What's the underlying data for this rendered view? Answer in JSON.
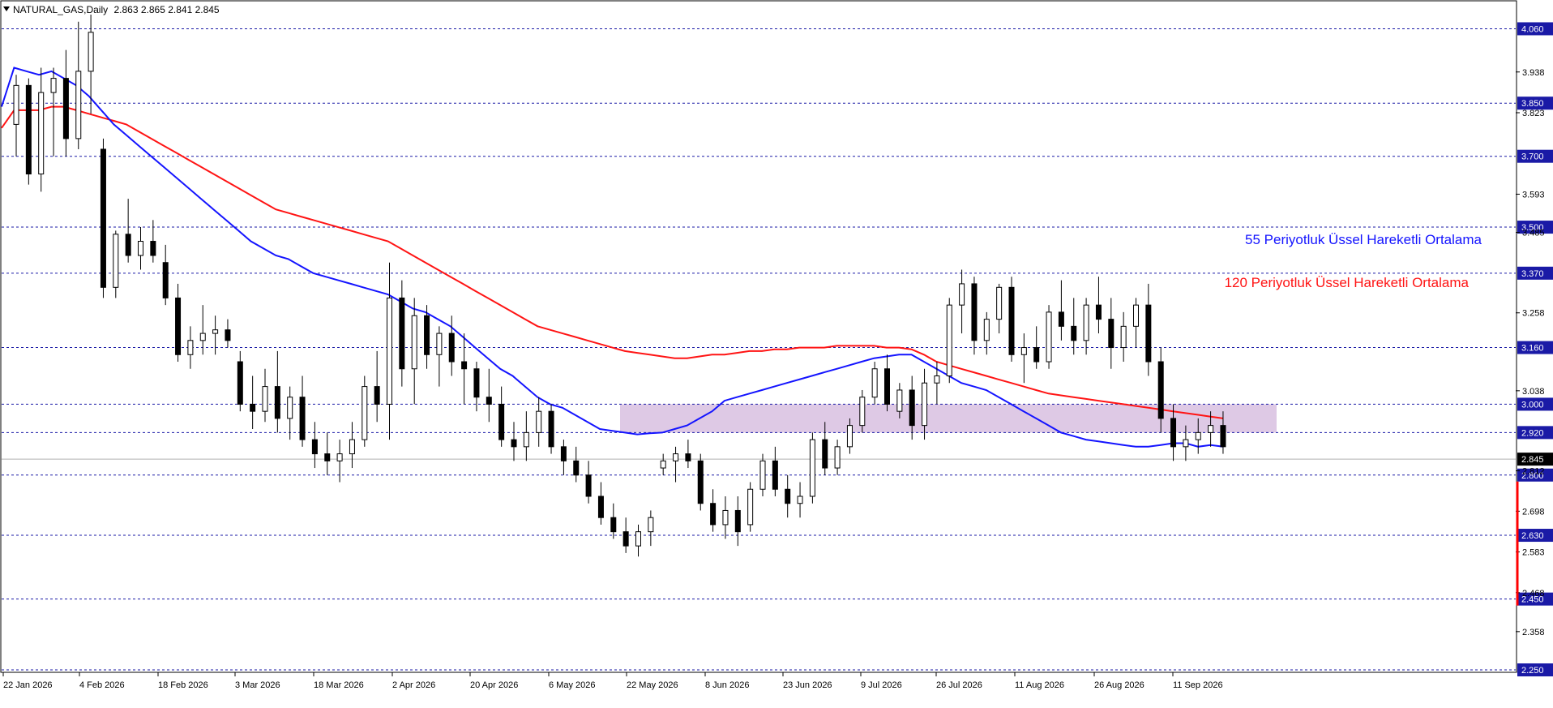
{
  "header": {
    "symbol": "NATURAL_GAS,Daily",
    "ohlc": "2.863 2.865 2.841 2.845"
  },
  "annotations": {
    "ema55_label": "55 Periyotluk Üssel Hareketli Ortalama",
    "ema120_label": "120 Periyotluk Üssel Hareketli Ortalama"
  },
  "colors": {
    "background": "#ffffff",
    "grid_dashed": "#1a1aa6",
    "ema55": "#1414ff",
    "ema120": "#ff1414",
    "zone": "#d8bfe0",
    "candle": "#000000",
    "price_tag_bg": "#1a1aa6",
    "last_price_tag_bg": "#000000",
    "range_marker": "#ff0000"
  },
  "chart_data": {
    "type": "candlestick",
    "symbol": "NATURAL_GAS",
    "timeframe": "Daily",
    "ylim": [
      2.25,
      4.1
    ],
    "x_tick_labels": [
      "22 Jan 2026",
      "4 Feb 2026",
      "18 Feb 2026",
      "3 Mar 2026",
      "18 Mar 2026",
      "2 Apr 2026",
      "20 Apr 2026",
      "6 May 2026",
      "22 May 2026",
      "8 Jun 2026",
      "23 Jun 2026",
      "9 Jul 2026",
      "26 Jul 2026",
      "11 Aug 2026",
      "26 Aug 2026",
      "11 Sep 2026"
    ],
    "y_tick_labels": [
      "3.938",
      "3.823",
      "3.593",
      "3.485",
      "3.258",
      "3.038",
      "2.812",
      "2.698",
      "2.583",
      "2.468",
      "2.358"
    ],
    "horizontal_levels": [
      4.06,
      3.85,
      3.7,
      3.5,
      3.37,
      3.16,
      3.0,
      2.92,
      2.8,
      2.63,
      2.45,
      2.25
    ],
    "last_price": 2.845,
    "zone": {
      "from": 2.92,
      "to": 3.0
    },
    "series": [
      {
        "name": "55 Periyotluk Üssel Hareketli Ortalama",
        "type": "ema"
      },
      {
        "name": "120 Periyotluk Üssel Hareketli Ortalama",
        "type": "ema"
      }
    ],
    "ema55": [
      3.84,
      3.95,
      3.94,
      3.93,
      3.94,
      3.92,
      3.9,
      3.87,
      3.83,
      3.79,
      3.76,
      3.73,
      3.7,
      3.67,
      3.64,
      3.61,
      3.58,
      3.55,
      3.52,
      3.49,
      3.46,
      3.44,
      3.42,
      3.41,
      3.39,
      3.37,
      3.36,
      3.35,
      3.34,
      3.33,
      3.32,
      3.31,
      3.29,
      3.27,
      3.26,
      3.24,
      3.22,
      3.19,
      3.16,
      3.13,
      3.1,
      3.08,
      3.05,
      3.02,
      3.0,
      2.99,
      2.97,
      2.95,
      2.93,
      2.925,
      2.92,
      2.915,
      2.918,
      2.92,
      2.93,
      2.94,
      2.96,
      2.98,
      3.01,
      3.02,
      3.03,
      3.04,
      3.05,
      3.06,
      3.07,
      3.08,
      3.09,
      3.1,
      3.11,
      3.12,
      3.13,
      3.135,
      3.14,
      3.14,
      3.12,
      3.1,
      3.08,
      3.06,
      3.05,
      3.04,
      3.02,
      3.0,
      2.98,
      2.96,
      2.94,
      2.92,
      2.91,
      2.9,
      2.895,
      2.89,
      2.885,
      2.88,
      2.88,
      2.885,
      2.89,
      2.89,
      2.88,
      2.885,
      2.88
    ],
    "ema120": [
      3.78,
      3.83,
      3.83,
      3.83,
      3.84,
      3.84,
      3.83,
      3.82,
      3.81,
      3.8,
      3.79,
      3.77,
      3.75,
      3.73,
      3.71,
      3.69,
      3.67,
      3.65,
      3.63,
      3.61,
      3.59,
      3.57,
      3.55,
      3.54,
      3.53,
      3.52,
      3.51,
      3.5,
      3.49,
      3.48,
      3.47,
      3.46,
      3.44,
      3.42,
      3.4,
      3.38,
      3.36,
      3.34,
      3.32,
      3.3,
      3.28,
      3.26,
      3.24,
      3.22,
      3.21,
      3.2,
      3.19,
      3.18,
      3.17,
      3.16,
      3.15,
      3.145,
      3.14,
      3.135,
      3.13,
      3.13,
      3.135,
      3.14,
      3.14,
      3.145,
      3.15,
      3.15,
      3.155,
      3.155,
      3.16,
      3.16,
      3.16,
      3.165,
      3.165,
      3.165,
      3.165,
      3.16,
      3.16,
      3.155,
      3.14,
      3.12,
      3.11,
      3.1,
      3.09,
      3.08,
      3.07,
      3.06,
      3.05,
      3.04,
      3.03,
      3.025,
      3.02,
      3.015,
      3.01,
      3.005,
      3.0,
      2.995,
      2.99,
      2.985,
      2.98,
      2.975,
      2.97,
      2.965,
      2.96
    ],
    "ohlc": [
      [
        3.79,
        3.93,
        3.7,
        3.9
      ],
      [
        3.9,
        3.92,
        3.62,
        3.65
      ],
      [
        3.65,
        3.95,
        3.6,
        3.88
      ],
      [
        3.88,
        3.95,
        3.7,
        3.92
      ],
      [
        3.92,
        4.0,
        3.7,
        3.75
      ],
      [
        3.75,
        4.08,
        3.72,
        3.94
      ],
      [
        3.94,
        4.1,
        3.82,
        4.05
      ],
      [
        3.72,
        3.75,
        3.3,
        3.33
      ],
      [
        3.33,
        3.49,
        3.3,
        3.48
      ],
      [
        3.48,
        3.58,
        3.4,
        3.42
      ],
      [
        3.42,
        3.5,
        3.38,
        3.46
      ],
      [
        3.46,
        3.52,
        3.4,
        3.42
      ],
      [
        3.4,
        3.45,
        3.28,
        3.3
      ],
      [
        3.3,
        3.34,
        3.12,
        3.14
      ],
      [
        3.14,
        3.22,
        3.1,
        3.18
      ],
      [
        3.18,
        3.28,
        3.14,
        3.2
      ],
      [
        3.2,
        3.25,
        3.14,
        3.21
      ],
      [
        3.21,
        3.24,
        3.16,
        3.18
      ],
      [
        3.12,
        3.15,
        2.98,
        3.0
      ],
      [
        3.0,
        3.08,
        2.93,
        2.98
      ],
      [
        2.98,
        3.1,
        2.95,
        3.05
      ],
      [
        3.05,
        3.15,
        2.92,
        2.96
      ],
      [
        2.96,
        3.05,
        2.9,
        3.02
      ],
      [
        3.02,
        3.08,
        2.88,
        2.9
      ],
      [
        2.9,
        2.95,
        2.82,
        2.86
      ],
      [
        2.86,
        2.92,
        2.8,
        2.84
      ],
      [
        2.84,
        2.9,
        2.78,
        2.86
      ],
      [
        2.86,
        2.95,
        2.82,
        2.9
      ],
      [
        2.9,
        3.08,
        2.88,
        3.05
      ],
      [
        3.05,
        3.15,
        2.95,
        3.0
      ],
      [
        3.0,
        3.4,
        2.9,
        3.3
      ],
      [
        3.3,
        3.35,
        3.05,
        3.1
      ],
      [
        3.1,
        3.3,
        3.0,
        3.25
      ],
      [
        3.25,
        3.28,
        3.1,
        3.14
      ],
      [
        3.14,
        3.22,
        3.05,
        3.2
      ],
      [
        3.2,
        3.25,
        3.08,
        3.12
      ],
      [
        3.12,
        3.2,
        3.0,
        3.1
      ],
      [
        3.1,
        3.12,
        2.98,
        3.02
      ],
      [
        3.02,
        3.1,
        2.95,
        3.0
      ],
      [
        3.0,
        3.05,
        2.88,
        2.9
      ],
      [
        2.9,
        2.95,
        2.84,
        2.88
      ],
      [
        2.88,
        2.98,
        2.84,
        2.92
      ],
      [
        2.92,
        3.02,
        2.88,
        2.98
      ],
      [
        2.98,
        3.0,
        2.86,
        2.88
      ],
      [
        2.88,
        2.9,
        2.8,
        2.84
      ],
      [
        2.84,
        2.88,
        2.78,
        2.8
      ],
      [
        2.8,
        2.84,
        2.72,
        2.74
      ],
      [
        2.74,
        2.78,
        2.66,
        2.68
      ],
      [
        2.68,
        2.72,
        2.62,
        2.64
      ],
      [
        2.64,
        2.68,
        2.58,
        2.6
      ],
      [
        2.6,
        2.66,
        2.57,
        2.64
      ],
      [
        2.64,
        2.7,
        2.6,
        2.68
      ],
      [
        2.82,
        2.86,
        2.8,
        2.84
      ],
      [
        2.84,
        2.88,
        2.78,
        2.86
      ],
      [
        2.86,
        2.9,
        2.82,
        2.84
      ],
      [
        2.84,
        2.86,
        2.7,
        2.72
      ],
      [
        2.72,
        2.76,
        2.64,
        2.66
      ],
      [
        2.66,
        2.74,
        2.62,
        2.7
      ],
      [
        2.7,
        2.74,
        2.6,
        2.64
      ],
      [
        2.66,
        2.78,
        2.64,
        2.76
      ],
      [
        2.76,
        2.86,
        2.74,
        2.84
      ],
      [
        2.84,
        2.88,
        2.74,
        2.76
      ],
      [
        2.76,
        2.8,
        2.68,
        2.72
      ],
      [
        2.72,
        2.78,
        2.68,
        2.74
      ],
      [
        2.74,
        2.92,
        2.72,
        2.9
      ],
      [
        2.9,
        2.95,
        2.8,
        2.82
      ],
      [
        2.82,
        2.9,
        2.8,
        2.88
      ],
      [
        2.88,
        2.96,
        2.86,
        2.94
      ],
      [
        2.94,
        3.04,
        2.92,
        3.02
      ],
      [
        3.02,
        3.12,
        3.0,
        3.1
      ],
      [
        3.1,
        3.14,
        2.98,
        3.0
      ],
      [
        2.98,
        3.06,
        2.96,
        3.04
      ],
      [
        3.04,
        3.08,
        2.9,
        2.94
      ],
      [
        2.94,
        3.1,
        2.9,
        3.06
      ],
      [
        3.06,
        3.12,
        3.0,
        3.08
      ],
      [
        3.08,
        3.3,
        3.06,
        3.28
      ],
      [
        3.28,
        3.38,
        3.2,
        3.34
      ],
      [
        3.34,
        3.36,
        3.14,
        3.18
      ],
      [
        3.18,
        3.26,
        3.14,
        3.24
      ],
      [
        3.24,
        3.34,
        3.2,
        3.33
      ],
      [
        3.33,
        3.36,
        3.12,
        3.14
      ],
      [
        3.14,
        3.2,
        3.06,
        3.16
      ],
      [
        3.16,
        3.22,
        3.1,
        3.12
      ],
      [
        3.12,
        3.28,
        3.1,
        3.26
      ],
      [
        3.26,
        3.35,
        3.18,
        3.22
      ],
      [
        3.22,
        3.3,
        3.14,
        3.18
      ],
      [
        3.18,
        3.3,
        3.14,
        3.28
      ],
      [
        3.28,
        3.36,
        3.2,
        3.24
      ],
      [
        3.24,
        3.3,
        3.1,
        3.16
      ],
      [
        3.16,
        3.26,
        3.12,
        3.22
      ],
      [
        3.22,
        3.3,
        3.16,
        3.28
      ],
      [
        3.28,
        3.34,
        3.08,
        3.12
      ],
      [
        3.12,
        3.16,
        2.92,
        2.96
      ],
      [
        2.96,
        3.0,
        2.84,
        2.88
      ],
      [
        2.88,
        2.94,
        2.84,
        2.9
      ],
      [
        2.9,
        2.96,
        2.86,
        2.92
      ],
      [
        2.92,
        2.98,
        2.88,
        2.94
      ],
      [
        2.94,
        2.98,
        2.86,
        2.88
      ]
    ]
  }
}
